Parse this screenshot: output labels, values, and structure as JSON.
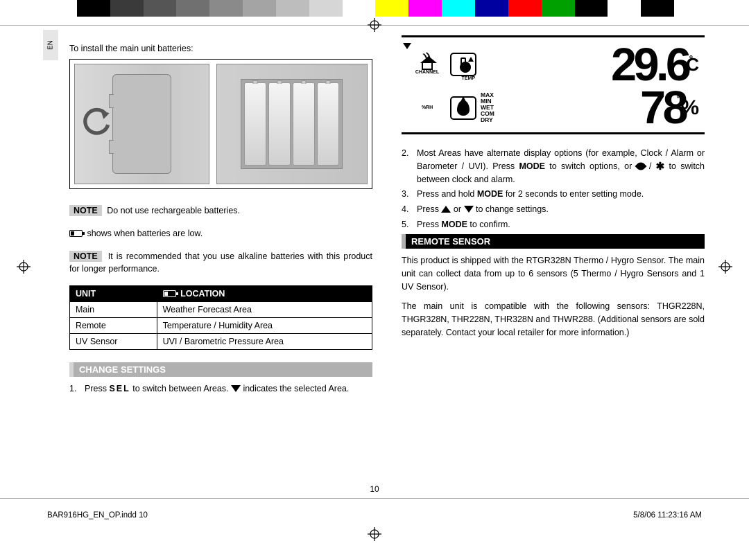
{
  "lang_tab": "EN",
  "left": {
    "intro": "To install the main unit batteries:",
    "note1_tag": "NOTE",
    "note1_text": "Do not use rechargeable batteries.",
    "low_batt_text": "shows when batteries are low.",
    "note2_tag": "NOTE",
    "note2_text": "It is recommended that you use alkaline batteries with this product for longer performance.",
    "table": {
      "head_unit": "UNIT",
      "head_loc": "LOCATION",
      "rows": [
        {
          "unit": "Main",
          "loc": "Weather Forecast Area"
        },
        {
          "unit": "Remote",
          "loc": "Temperature / Humidity Area"
        },
        {
          "unit": "UV Sensor",
          "loc": "UVI / Barometric Pressure Area"
        }
      ]
    },
    "section1_title": "CHANGE SETTINGS",
    "step1_num": "1.",
    "step1_a": "Press ",
    "step1_sel": "SEL",
    "step1_b": " to switch between Areas. ",
    "step1_c": " indicates the selected Area."
  },
  "right": {
    "lcd": {
      "channel_label": "CHANNEL",
      "rh_label": "%RH",
      "temp_label": "TEMP",
      "words": [
        "MAX",
        "MIN",
        "WET",
        "COM",
        "DRY"
      ],
      "temp_value": "29.6",
      "temp_unit": "C",
      "hum_value": "78",
      "hum_unit": "%"
    },
    "step2_num": "2.",
    "step2_a": "Most Areas have alternate display options (for example, Clock / Alarm or Barometer / UVI). Press ",
    "step2_mode": "MODE",
    "step2_b": " to switch options, or ",
    "step2_c": " / ",
    "step2_d": " to switch between clock and alarm.",
    "step3_num": "3.",
    "step3_a": "Press and hold ",
    "step3_mode": "MODE",
    "step3_b": " for 2 seconds to enter setting mode.",
    "step4_num": "4.",
    "step4_a": "Press ",
    "step4_b": " or ",
    "step4_c": " to change settings.",
    "step5_num": "5.",
    "step5_a": "Press ",
    "step5_mode": "MODE",
    "step5_b": " to confirm.",
    "section2_title": "REMOTE SENSOR",
    "para1": "This product is shipped with the RTGR328N Thermo / Hygro Sensor. The main unit can collect data from up to 6 sensors (5 Thermo / Hygro Sensors and 1 UV Sensor).",
    "para2": "The main unit is compatible with the following sensors: THGR228N, THGR328N, THR228N, THR328N and THWR288. (Additional sensors are sold separately. Contact your local retailer for more information.)"
  },
  "page_number": "10",
  "footer_left": "BAR916HG_EN_OP.indd   10",
  "footer_right": "5/8/06   11:23:16 AM",
  "colorbar": [
    "#fff",
    "#000",
    "#3a3a3a",
    "#555",
    "#707070",
    "#8a8a8a",
    "#a4a4a4",
    "#bdbdbd",
    "#d6d6d6",
    "#fff",
    "#ffff00",
    "#ff00ff",
    "#00ffff",
    "#0000a0",
    "#ff0000",
    "#00a000",
    "#000",
    "#fff",
    "#000",
    "#fff"
  ]
}
